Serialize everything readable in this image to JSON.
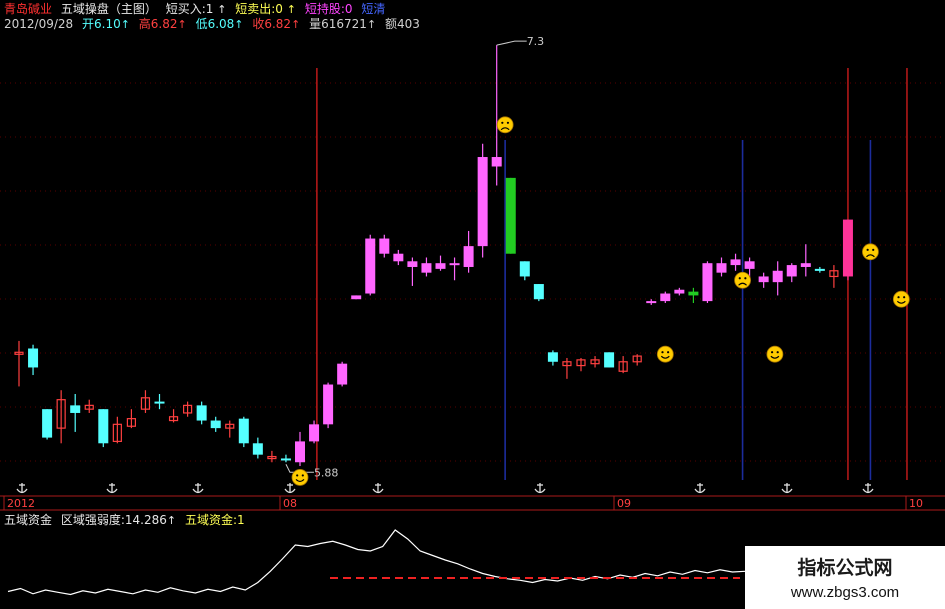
{
  "header": {
    "stock_name": "青岛碱业",
    "indicator_title": "五域操盘（主图）",
    "short_buy_label": "短买入:1",
    "short_sell_label": "短卖出:0",
    "short_hold_label": "短持股:0",
    "short_clear_label": "短清",
    "date": "2012/09/28",
    "open": "开6.10",
    "high": "高6.82",
    "low": "低6.08",
    "close": "收6.82",
    "volume": "量616721",
    "amount": "额403",
    "arrow": "↑"
  },
  "lower_panel": {
    "indicator_name": "五域资金",
    "strength_label": "区域强弱度:14.286",
    "fund_label": "五域资金:1",
    "arrow": "↑"
  },
  "colors": {
    "up_candle": "#ff66ff",
    "down_candle": "#55ffff",
    "small_candle_red": "#ff4040",
    "buy_line": "#b01818",
    "sell_line": "#1c2c9c",
    "green_bar": "#22cc22",
    "smiley": "#ffcc00",
    "baseline": "#ee2222",
    "grid": "#5a0000",
    "line": "#ffffff"
  },
  "chart_data": {
    "type": "candlestick",
    "date_axis_labels": [
      "2012",
      "08",
      "09",
      "10"
    ],
    "peak_annotation": "7.3",
    "low_annotation": "5.88",
    "icons": [
      "anchor-icon",
      "smile-icon",
      "frown-icon"
    ],
    "candles": [
      {
        "o": 5.7,
        "h": 5.76,
        "l": 5.52,
        "c": 5.7,
        "t": "red"
      },
      {
        "o": 5.72,
        "h": 5.74,
        "l": 5.58,
        "c": 5.62,
        "t": "cyan"
      },
      {
        "o": 5.4,
        "h": 5.4,
        "l": 5.24,
        "c": 5.25,
        "t": "cyan"
      },
      {
        "o": 5.3,
        "h": 5.5,
        "l": 5.22,
        "c": 5.45,
        "t": "red"
      },
      {
        "o": 5.42,
        "h": 5.48,
        "l": 5.28,
        "c": 5.38,
        "t": "cyan"
      },
      {
        "o": 5.4,
        "h": 5.45,
        "l": 5.38,
        "c": 5.42,
        "t": "red"
      },
      {
        "o": 5.4,
        "h": 5.4,
        "l": 5.2,
        "c": 5.22,
        "t": "cyan"
      },
      {
        "o": 5.23,
        "h": 5.36,
        "l": 5.22,
        "c": 5.32,
        "t": "red"
      },
      {
        "o": 5.31,
        "h": 5.4,
        "l": 5.3,
        "c": 5.35,
        "t": "red"
      },
      {
        "o": 5.4,
        "h": 5.5,
        "l": 5.38,
        "c": 5.46,
        "t": "red"
      },
      {
        "o": 5.43,
        "h": 5.48,
        "l": 5.4,
        "c": 5.44,
        "t": "cyan"
      },
      {
        "o": 5.34,
        "h": 5.4,
        "l": 5.33,
        "c": 5.36,
        "t": "red"
      },
      {
        "o": 5.38,
        "h": 5.44,
        "l": 5.36,
        "c": 5.42,
        "t": "red"
      },
      {
        "o": 5.42,
        "h": 5.44,
        "l": 5.32,
        "c": 5.34,
        "t": "cyan"
      },
      {
        "o": 5.34,
        "h": 5.36,
        "l": 5.28,
        "c": 5.3,
        "t": "cyan"
      },
      {
        "o": 5.3,
        "h": 5.34,
        "l": 5.25,
        "c": 5.32,
        "t": "red"
      },
      {
        "o": 5.35,
        "h": 5.36,
        "l": 5.2,
        "c": 5.22,
        "t": "cyan"
      },
      {
        "o": 5.22,
        "h": 5.25,
        "l": 5.14,
        "c": 5.16,
        "t": "cyan"
      },
      {
        "o": 5.14,
        "h": 5.18,
        "l": 5.12,
        "c": 5.15,
        "t": "red"
      },
      {
        "o": 5.14,
        "h": 5.16,
        "l": 5.12,
        "c": 5.13,
        "t": "cyan"
      },
      {
        "o": 5.12,
        "h": 5.28,
        "l": 5.1,
        "c": 5.23,
        "t": "pink"
      },
      {
        "o": 5.23,
        "h": 5.34,
        "l": 5.22,
        "c": 5.32,
        "t": "pink"
      },
      {
        "o": 5.32,
        "h": 5.54,
        "l": 5.3,
        "c": 5.53,
        "t": "pink"
      },
      {
        "o": 5.53,
        "h": 5.65,
        "l": 5.52,
        "c": 5.64,
        "t": "pink"
      },
      {
        "o": 5.98,
        "h": 6.0,
        "l": 5.98,
        "c": 6.0,
        "t": "pink"
      },
      {
        "o": 6.01,
        "h": 6.32,
        "l": 6.0,
        "c": 6.3,
        "t": "pink"
      },
      {
        "o": 6.3,
        "h": 6.32,
        "l": 6.2,
        "c": 6.22,
        "t": "pink"
      },
      {
        "o": 6.22,
        "h": 6.24,
        "l": 6.16,
        "c": 6.18,
        "t": "pink"
      },
      {
        "o": 6.18,
        "h": 6.2,
        "l": 6.05,
        "c": 6.15,
        "t": "pink"
      },
      {
        "o": 6.17,
        "h": 6.2,
        "l": 6.1,
        "c": 6.12,
        "t": "pink"
      },
      {
        "o": 6.14,
        "h": 6.21,
        "l": 6.13,
        "c": 6.17,
        "t": "pink"
      },
      {
        "o": 6.17,
        "h": 6.2,
        "l": 6.08,
        "c": 6.16,
        "t": "pink"
      },
      {
        "o": 6.15,
        "h": 6.34,
        "l": 6.12,
        "c": 6.26,
        "t": "pink"
      },
      {
        "o": 6.26,
        "h": 6.8,
        "l": 6.2,
        "c": 6.73,
        "t": "pink"
      },
      {
        "o": 6.73,
        "h": 7.32,
        "l": 6.58,
        "c": 6.68,
        "t": "pink"
      },
      {
        "o": 6.62,
        "h": 6.62,
        "l": 6.22,
        "c": 6.22,
        "t": "green"
      },
      {
        "o": 6.18,
        "h": 6.18,
        "l": 6.08,
        "c": 6.1,
        "t": "cyan"
      },
      {
        "o": 6.06,
        "h": 6.06,
        "l": 5.97,
        "c": 5.98,
        "t": "cyan"
      },
      {
        "o": 5.7,
        "h": 5.71,
        "l": 5.63,
        "c": 5.65,
        "t": "cyan"
      },
      {
        "o": 5.65,
        "h": 5.67,
        "l": 5.56,
        "c": 5.63,
        "t": "red"
      },
      {
        "o": 5.63,
        "h": 5.67,
        "l": 5.6,
        "c": 5.66,
        "t": "red"
      },
      {
        "o": 5.66,
        "h": 5.68,
        "l": 5.62,
        "c": 5.64,
        "t": "red"
      },
      {
        "o": 5.7,
        "h": 5.7,
        "l": 5.62,
        "c": 5.62,
        "t": "cyan"
      },
      {
        "o": 5.6,
        "h": 5.68,
        "l": 5.59,
        "c": 5.65,
        "t": "red"
      },
      {
        "o": 5.65,
        "h": 5.69,
        "l": 5.63,
        "c": 5.68,
        "t": "red"
      },
      {
        "o": 5.96,
        "h": 5.98,
        "l": 5.95,
        "c": 5.97,
        "t": "pink"
      },
      {
        "o": 5.97,
        "h": 6.02,
        "l": 5.96,
        "c": 6.01,
        "t": "pink"
      },
      {
        "o": 6.01,
        "h": 6.04,
        "l": 6.0,
        "c": 6.03,
        "t": "pink"
      },
      {
        "o": 6.0,
        "h": 6.04,
        "l": 5.96,
        "c": 6.02,
        "t": "green"
      },
      {
        "o": 5.97,
        "h": 6.18,
        "l": 5.96,
        "c": 6.17,
        "t": "pink"
      },
      {
        "o": 6.12,
        "h": 6.2,
        "l": 6.1,
        "c": 6.17,
        "t": "pink"
      },
      {
        "o": 6.16,
        "h": 6.22,
        "l": 6.13,
        "c": 6.19,
        "t": "pink"
      },
      {
        "o": 6.18,
        "h": 6.2,
        "l": 6.08,
        "c": 6.14,
        "t": "pink"
      },
      {
        "o": 6.1,
        "h": 6.12,
        "l": 6.04,
        "c": 6.07,
        "t": "pink"
      },
      {
        "o": 6.07,
        "h": 6.18,
        "l": 6.0,
        "c": 6.13,
        "t": "pink"
      },
      {
        "o": 6.1,
        "h": 6.17,
        "l": 6.07,
        "c": 6.16,
        "t": "pink"
      },
      {
        "o": 6.15,
        "h": 6.27,
        "l": 6.1,
        "c": 6.17,
        "t": "pink"
      },
      {
        "o": 6.13,
        "h": 6.15,
        "l": 6.12,
        "c": 6.14,
        "t": "cyan"
      },
      {
        "o": 6.13,
        "h": 6.16,
        "l": 6.04,
        "c": 6.1,
        "t": "red"
      },
      {
        "o": 6.1,
        "h": 6.4,
        "l": 6.08,
        "c": 6.4,
        "t": "magenta"
      }
    ],
    "fund_line": [
      0.18,
      0.22,
      0.15,
      0.2,
      0.17,
      0.14,
      0.19,
      0.16,
      0.21,
      0.18,
      0.15,
      0.2,
      0.17,
      0.23,
      0.19,
      0.16,
      0.21,
      0.18,
      0.24,
      0.2,
      0.3,
      0.45,
      0.62,
      0.8,
      0.78,
      0.82,
      0.85,
      0.8,
      0.74,
      0.72,
      0.78,
      1.0,
      0.88,
      0.72,
      0.66,
      0.6,
      0.55,
      0.48,
      0.42,
      0.38,
      0.35,
      0.33,
      0.3,
      0.34,
      0.32,
      0.36,
      0.33,
      0.38,
      0.35,
      0.4,
      0.37,
      0.42,
      0.39,
      0.44,
      0.41,
      0.46,
      0.43,
      0.47,
      0.44,
      0.45
    ],
    "baseline_level": 0.36,
    "xlabel": "",
    "ylabel": ""
  },
  "watermark": {
    "title": "指标公式网",
    "url": "www.zbgs3.com"
  }
}
